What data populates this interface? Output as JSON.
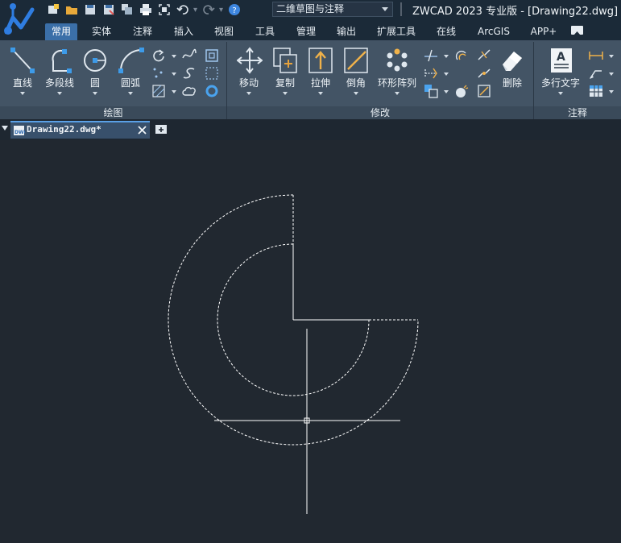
{
  "title_bar": {
    "workspace": "二维草图与注释",
    "app_title": "ZWCAD 2023 专业版 - [Drawing22.dwg]"
  },
  "tabs": [
    "常用",
    "实体",
    "注释",
    "插入",
    "视图",
    "工具",
    "管理",
    "输出",
    "扩展工具",
    "在线",
    "ArcGIS",
    "APP+"
  ],
  "active_tab": "常用",
  "ribbon": {
    "draw": {
      "title": "绘图",
      "line": "直线",
      "polyline": "多段线",
      "circle": "圆",
      "arc": "圆弧"
    },
    "modify": {
      "title": "修改",
      "move": "移动",
      "copy": "复制",
      "stretch": "拉伸",
      "chamfer": "倒角",
      "polar_array": "环形阵列",
      "erase": "删除"
    },
    "annotation": {
      "title": "注释",
      "mtext": "多行文字"
    }
  },
  "document_tab": {
    "name": "Drawing22.dwg*"
  },
  "colors": {
    "accent": "#3b6fa8",
    "ribbon_bg": "#435465",
    "canvas_bg": "#212830",
    "drawing_line": "#ffffff"
  }
}
